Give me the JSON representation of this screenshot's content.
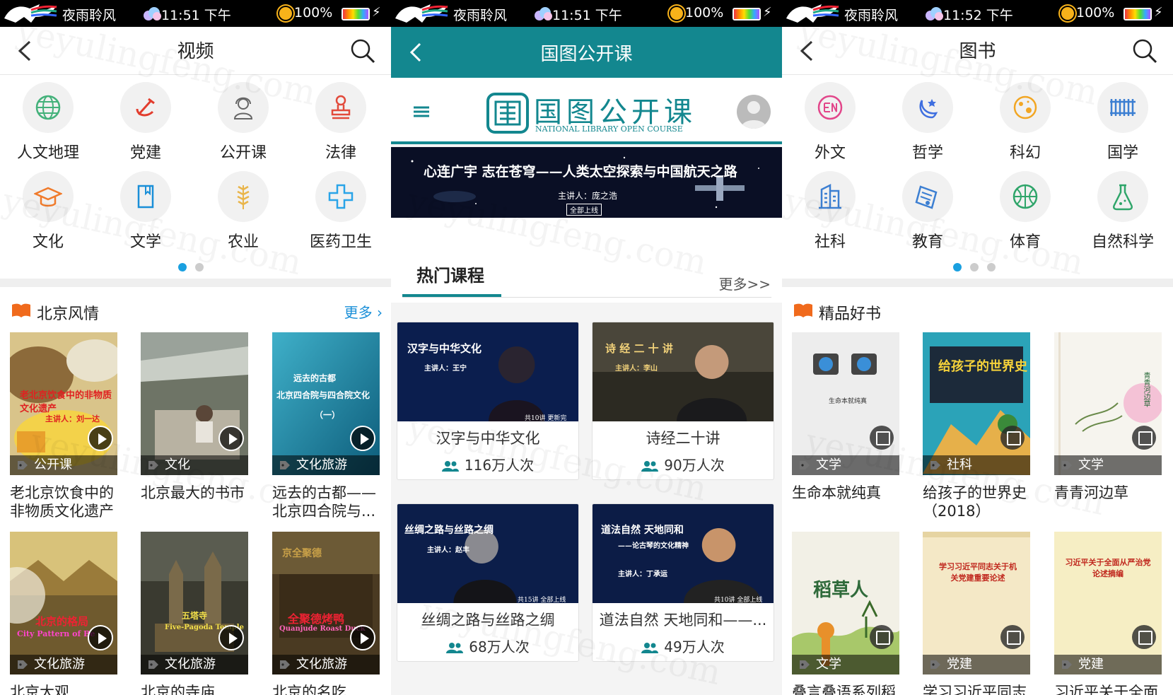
{
  "status_bars": [
    {
      "name": "夜雨聆风",
      "time": "11:51 下午",
      "battery": "100%"
    },
    {
      "name": "夜雨聆风",
      "time": "11:51 下午",
      "battery": "100%"
    },
    {
      "name": "夜雨聆风",
      "time": "11:52 下午",
      "battery": "100%"
    }
  ],
  "video": {
    "title": "视频",
    "categories": [
      {
        "label": "人文地理",
        "icon": "globe-icon"
      },
      {
        "label": "党建",
        "icon": "party-emblem-icon"
      },
      {
        "label": "公开课",
        "icon": "headset-person-icon"
      },
      {
        "label": "法律",
        "icon": "stamp-icon"
      },
      {
        "label": "文化",
        "icon": "graduation-cap-icon"
      },
      {
        "label": "文学",
        "icon": "book-icon"
      },
      {
        "label": "农业",
        "icon": "wheat-icon"
      },
      {
        "label": "医药卫生",
        "icon": "medical-cross-icon"
      }
    ],
    "pages": 2,
    "active_page": 1,
    "section_title": "北京风情",
    "more": "更多",
    "items": [
      {
        "tag": "公开课",
        "caption": "老北京饮食中的非物质文化遗产",
        "overlay": "老北京饮食中的非物质文化遗产",
        "overlay_sub": "主讲人：刘一达"
      },
      {
        "tag": "文化",
        "caption": "北京最大的书市",
        "overlay": "",
        "overlay_sub": ""
      },
      {
        "tag": "文化旅游",
        "caption": "远去的古都——北京四合院与...",
        "overlay": "远去的古都",
        "overlay_sub": "北京四合院与四合院文化",
        "overlay_sub2": "（一）"
      },
      {
        "tag": "文化旅游",
        "caption": "北京大观",
        "overlay": "北京的格局",
        "overlay_sub": "City Pattern of Be"
      },
      {
        "tag": "文化旅游",
        "caption": "北京的寺庙",
        "overlay": "五塔寺",
        "overlay_sub": "Five-Pagoda Temple"
      },
      {
        "tag": "文化旅游",
        "caption": "北京的名吃",
        "overlay": "全聚德烤鸭",
        "overlay_sub": "Quanjude Roast Duck",
        "overlay_top": "京全聚德"
      }
    ]
  },
  "lecture": {
    "title": "国图公开课",
    "logo_cn": "国图公开课",
    "logo_en": "NATIONAL LIBRARY OPEN COURSE",
    "banner_title": "心连广宇 志在苍穹——人类太空探索与中国航天之路",
    "banner_speaker": "主讲人：庞之浩",
    "banner_button": "全部上线",
    "hot_title": "热门课程",
    "hot_more": "更多>>",
    "courses": [
      {
        "title": "汉字与中华文化",
        "views": "116万人次",
        "overlay": "汉字与中华文化",
        "speaker": "主讲人：王宁",
        "episodes": "共10讲 更新完"
      },
      {
        "title": "诗经二十讲",
        "views": "90万人次",
        "overlay": "诗 经 二 十 讲",
        "speaker": "主讲人：李山",
        "episodes": ""
      },
      {
        "title": "丝绸之路与丝路之绸",
        "views": "68万人次",
        "overlay": "丝绸之路与丝路之绸",
        "speaker": "主讲人：赵丰",
        "episodes": "共15讲 全部上线"
      },
      {
        "title": "道法自然 天地同和——...",
        "views": "49万人次",
        "overlay": "道法自然 天地同和",
        "overlay_sub": "——论古琴的文化精神",
        "speaker": "主讲人：丁承运",
        "episodes": "共10讲 全部上线"
      }
    ]
  },
  "books": {
    "title": "图书",
    "categories": [
      {
        "label": "外文",
        "icon": "foreign-language-icon"
      },
      {
        "label": "哲学",
        "icon": "moon-star-icon"
      },
      {
        "label": "科幻",
        "icon": "planet-icon"
      },
      {
        "label": "国学",
        "icon": "bamboo-slips-icon"
      },
      {
        "label": "社科",
        "icon": "building-doc-icon"
      },
      {
        "label": "教育",
        "icon": "certificate-icon"
      },
      {
        "label": "体育",
        "icon": "basketball-icon"
      },
      {
        "label": "自然科学",
        "icon": "flask-icon"
      }
    ],
    "pages": 3,
    "active_page": 1,
    "section_title": "精品好书",
    "items": [
      {
        "tag": "文学",
        "caption": "生命本就纯真",
        "cover_text": "生命本就纯真"
      },
      {
        "tag": "社科",
        "caption": "给孩子的世界史（2018）",
        "cover_text": "给孩子的世界史"
      },
      {
        "tag": "文学",
        "caption": "青青河边草",
        "cover_text": "青青河边草"
      },
      {
        "tag": "文学",
        "caption": "叠言叠语系列稻",
        "cover_text": "稻草人"
      },
      {
        "tag": "党建",
        "caption": "学习习近平同志",
        "cover_text": "学习习近平同志关于机关党建重要论述"
      },
      {
        "tag": "党建",
        "caption": "习近平关于全面",
        "cover_text": "习近平关于全面从严治党论述摘编"
      }
    ]
  },
  "watermark": "yeyulingfeng.com",
  "colors": {
    "teal": "#13878f",
    "accent_blue": "#1a8fd8",
    "section_orange": "#f06a1c",
    "dot_active": "#1aa0e0"
  }
}
